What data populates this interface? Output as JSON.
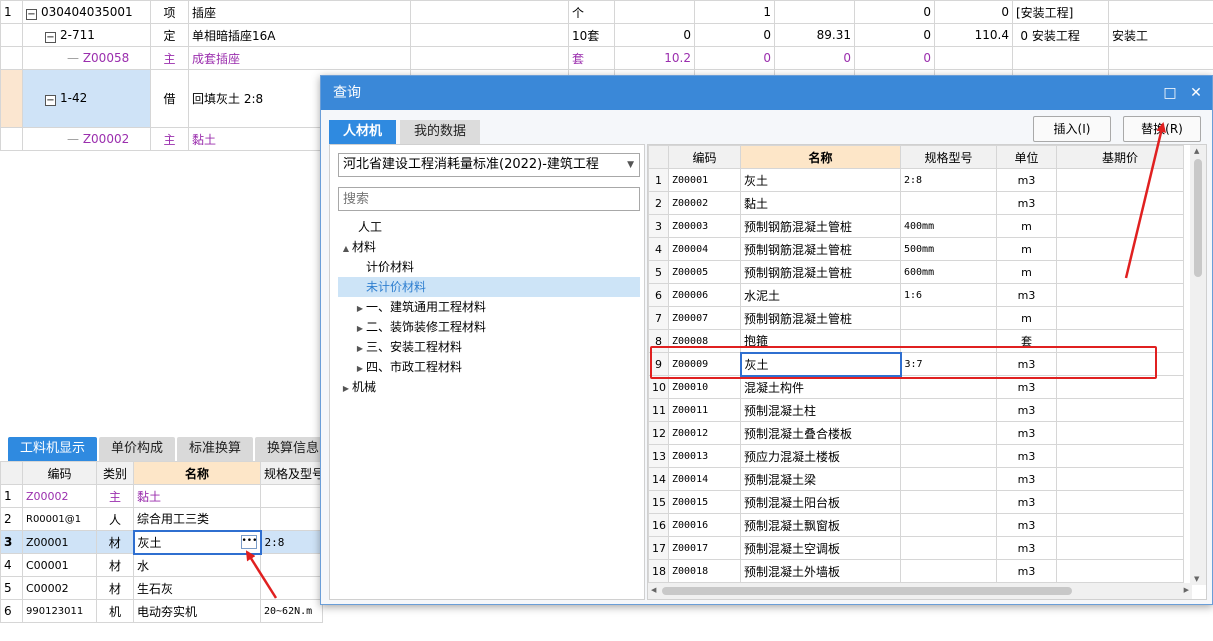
{
  "top_table": {
    "rows": [
      {
        "no": "1",
        "code": "030404035001",
        "type": "项",
        "name": "插座",
        "unit": "个",
        "qty": "",
        "c1": "1",
        "c2": "",
        "c3": "0",
        "c4": "0",
        "c5": "[安装工程]",
        "c6": ""
      },
      {
        "no": "",
        "code": "2-711",
        "type": "定",
        "name": "单相暗插座16A",
        "unit": "10套",
        "qty": "0",
        "c1": "0",
        "c2": "89.31",
        "c3": "0",
        "c4": "110.4",
        "c5": "0",
        "c6": "安装工程",
        "c7": "安装工"
      },
      {
        "no": "",
        "code": "Z00058",
        "type": "主",
        "name": "成套插座",
        "unit": "套",
        "qty": "10.2",
        "c1": "0",
        "c2": "0",
        "c3": "0"
      },
      {
        "no": "",
        "code": "1-42",
        "type": "借",
        "name": "回填灰土 2:8"
      },
      {
        "no": "",
        "code": "Z00002",
        "type": "主",
        "name": "黏土"
      }
    ]
  },
  "lower_panel": {
    "tabs": [
      "工料机显示",
      "单价构成",
      "标准换算",
      "换算信息"
    ],
    "headers": [
      "编码",
      "类别",
      "名称",
      "规格及型号"
    ],
    "rows": [
      {
        "no": "1",
        "code": "Z00002",
        "type": "主",
        "name": "黏土",
        "spec": ""
      },
      {
        "no": "2",
        "code": "R00001@1",
        "type": "人",
        "name": "综合用工三类",
        "spec": ""
      },
      {
        "no": "3",
        "code": "Z00001",
        "type": "材",
        "name": "灰土",
        "spec": "2:8"
      },
      {
        "no": "4",
        "code": "C00001",
        "type": "材",
        "name": "水",
        "spec": ""
      },
      {
        "no": "5",
        "code": "C00002",
        "type": "材",
        "name": "生石灰",
        "spec": ""
      },
      {
        "no": "6",
        "code": "990123011",
        "type": "机",
        "name": "电动夯实机",
        "spec": "20~62N.m"
      }
    ]
  },
  "dialog": {
    "title": "查询",
    "tabs": [
      "人材机",
      "我的数据"
    ],
    "insert_button": "插入(I)",
    "replace_button": "替换(R)",
    "library_select": "河北省建设工程消耗量标准(2022)-建筑工程",
    "search_placeholder": "搜索",
    "tree": [
      {
        "label": "人工",
        "level": 0,
        "arrow": ""
      },
      {
        "label": "材料",
        "level": 0,
        "arrow": "▲"
      },
      {
        "label": "计价材料",
        "level": 1,
        "arrow": ""
      },
      {
        "label": "未计价材料",
        "level": 1,
        "arrow": "",
        "selected": true
      },
      {
        "label": "一、建筑通用工程材料",
        "level": 1,
        "arrow": "▶"
      },
      {
        "label": "二、装饰装修工程材料",
        "level": 1,
        "arrow": "▶"
      },
      {
        "label": "三、安装工程材料",
        "level": 1,
        "arrow": "▶"
      },
      {
        "label": "四、市政工程材料",
        "level": 1,
        "arrow": "▶"
      },
      {
        "label": "机械",
        "level": 0,
        "arrow": "▶"
      }
    ],
    "table_headers": [
      "编码",
      "名称",
      "规格型号",
      "单位",
      "基期价"
    ],
    "rows": [
      {
        "no": "1",
        "code": "Z00001",
        "name": "灰土",
        "spec": "2:8",
        "unit": "m3"
      },
      {
        "no": "2",
        "code": "Z00002",
        "name": "黏土",
        "spec": "",
        "unit": "m3"
      },
      {
        "no": "3",
        "code": "Z00003",
        "name": "预制钢筋混凝土管桩",
        "spec": "400mm",
        "unit": "m"
      },
      {
        "no": "4",
        "code": "Z00004",
        "name": "预制钢筋混凝土管桩",
        "spec": "500mm",
        "unit": "m"
      },
      {
        "no": "5",
        "code": "Z00005",
        "name": "预制钢筋混凝土管桩",
        "spec": "600mm",
        "unit": "m"
      },
      {
        "no": "6",
        "code": "Z00006",
        "name": "水泥土",
        "spec": "1:6",
        "unit": "m3"
      },
      {
        "no": "7",
        "code": "Z00007",
        "name": "预制钢筋混凝土管桩",
        "spec": "",
        "unit": "m"
      },
      {
        "no": "8",
        "code": "Z00008",
        "name": "抱箍",
        "spec": "",
        "unit": "套"
      },
      {
        "no": "9",
        "code": "Z00009",
        "name": "灰土",
        "spec": "3:7",
        "unit": "m3"
      },
      {
        "no": "10",
        "code": "Z00010",
        "name": "混凝土构件",
        "spec": "",
        "unit": "m3"
      },
      {
        "no": "11",
        "code": "Z00011",
        "name": "预制混凝土柱",
        "spec": "",
        "unit": "m3"
      },
      {
        "no": "12",
        "code": "Z00012",
        "name": "预制混凝土叠合楼板",
        "spec": "",
        "unit": "m3"
      },
      {
        "no": "13",
        "code": "Z00013",
        "name": "预应力混凝土楼板",
        "spec": "",
        "unit": "m3"
      },
      {
        "no": "14",
        "code": "Z00014",
        "name": "预制混凝土梁",
        "spec": "",
        "unit": "m3"
      },
      {
        "no": "15",
        "code": "Z00015",
        "name": "预制混凝土阳台板",
        "spec": "",
        "unit": "m3"
      },
      {
        "no": "16",
        "code": "Z00016",
        "name": "预制混凝土飘窗板",
        "spec": "",
        "unit": "m3"
      },
      {
        "no": "17",
        "code": "Z00017",
        "name": "预制混凝土空调板",
        "spec": "",
        "unit": "m3"
      },
      {
        "no": "18",
        "code": "Z00018",
        "name": "预制混凝土外墙板",
        "spec": "",
        "unit": "m3"
      }
    ]
  },
  "colors": {
    "accent": "#2f8ae0",
    "annotation": "#e02020",
    "selection": "#cfe3f7",
    "header_highlight": "#fde6c8",
    "material_code": "#9b2fae"
  }
}
